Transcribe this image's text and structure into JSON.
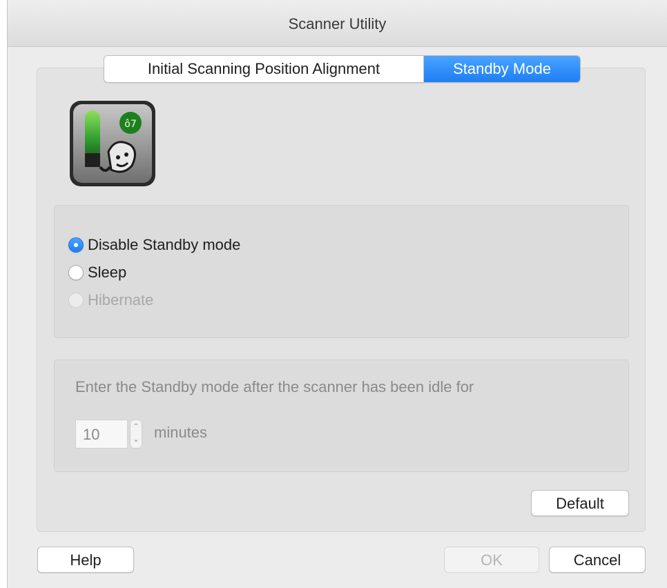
{
  "window": {
    "title": "Scanner Utility"
  },
  "tabs": [
    {
      "label": "Initial Scanning Position Alignment",
      "selected": false
    },
    {
      "label": "Standby Mode",
      "selected": true
    }
  ],
  "app_icon": {
    "name": "standby-mode-icon"
  },
  "standby_options": {
    "selected": "Disable Standby mode",
    "items": [
      {
        "label": "Disable Standby mode",
        "checked": true,
        "enabled": true
      },
      {
        "label": "Sleep",
        "checked": false,
        "enabled": true
      },
      {
        "label": "Hibernate",
        "checked": false,
        "enabled": false
      }
    ]
  },
  "idle": {
    "text": "Enter the Standby mode after the scanner has been idle for",
    "value": "10",
    "unit": "minutes",
    "stepper_icon": "stepper-arrows-icon"
  },
  "buttons": {
    "default": "Default",
    "help": "Help",
    "ok": "OK",
    "cancel": "Cancel"
  },
  "colors": {
    "accent": "#1e7ef3",
    "window_bg": "#ececec",
    "disabled_text": "#a8a8a8"
  }
}
